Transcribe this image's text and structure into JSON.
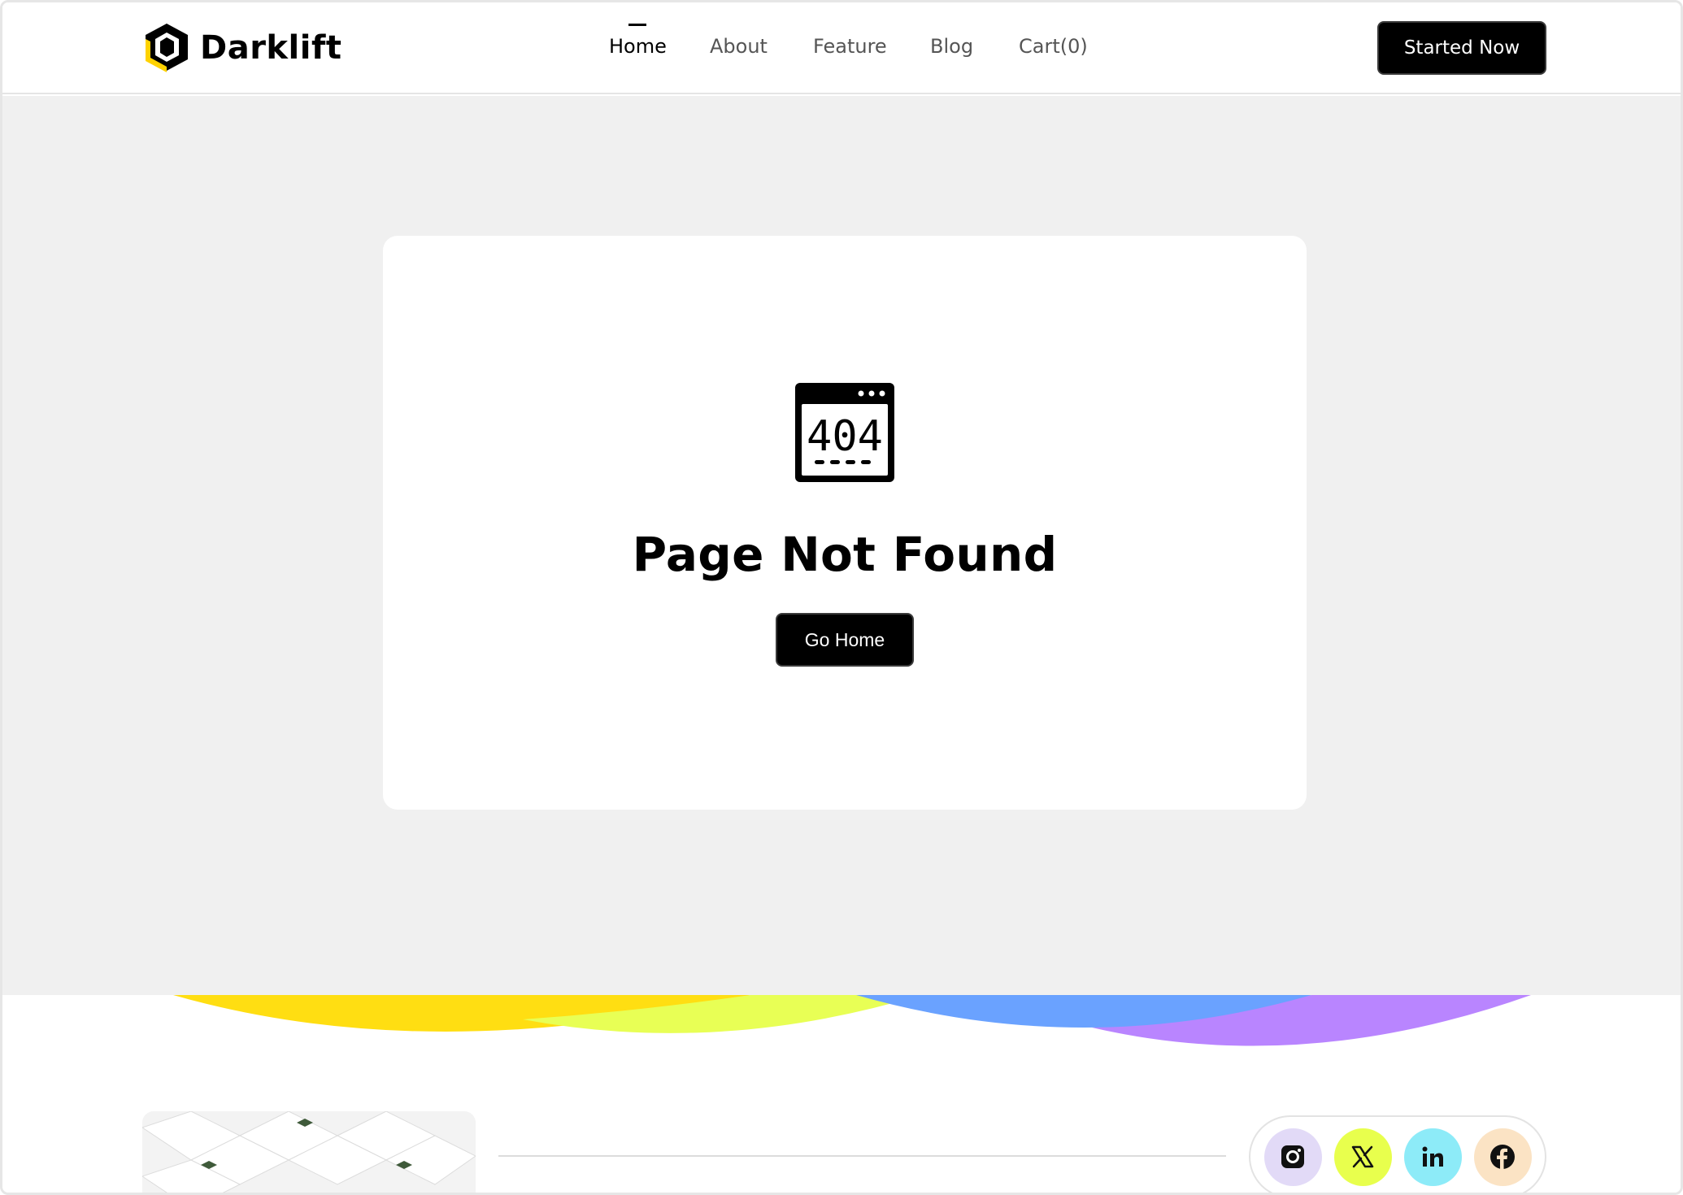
{
  "brand": {
    "name": "Darklift",
    "accent": "#FFD200"
  },
  "nav": {
    "items": [
      {
        "label": "Home",
        "active": true
      },
      {
        "label": "About",
        "active": false
      },
      {
        "label": "Feature",
        "active": false
      },
      {
        "label": "Blog",
        "active": false
      },
      {
        "label": "Cart(0)",
        "active": false
      }
    ]
  },
  "header": {
    "cta_label": "Started Now"
  },
  "error": {
    "icon_text": "404",
    "title": "Page Not Found",
    "button_label": "Go Home"
  },
  "colors": {
    "page_bg": "#f0f0f0",
    "card_bg": "#ffffff",
    "button_bg": "#000000",
    "wave_yellow": "#FFDE12",
    "wave_lime": "#E8FF55",
    "wave_blue": "#6AA2FF",
    "wave_purple": "#B985FF"
  },
  "social": [
    {
      "name": "instagram-icon",
      "bg": "#E2DAF7"
    },
    {
      "name": "x-icon",
      "bg": "#E8FF4D"
    },
    {
      "name": "linkedin-icon",
      "bg": "#8DEBF8"
    },
    {
      "name": "facebook-icon",
      "bg": "#FBE3C4"
    }
  ]
}
